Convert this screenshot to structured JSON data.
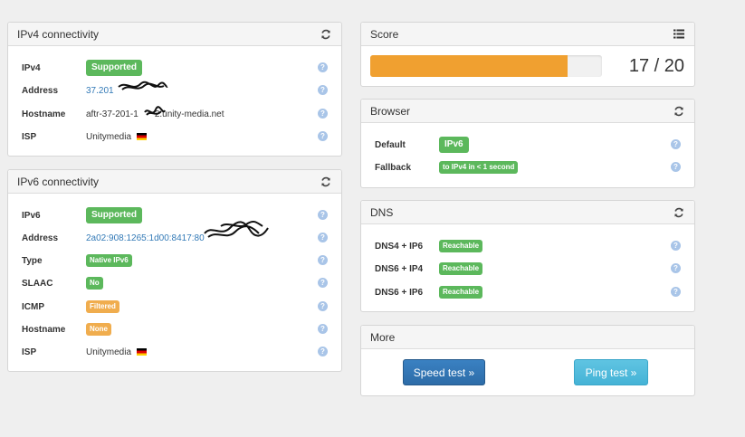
{
  "ipv4": {
    "title": "IPv4 connectivity",
    "rows": [
      {
        "key": "IPv4",
        "badge": "Supported"
      },
      {
        "key": "Address",
        "value": "37.201"
      },
      {
        "key": "Hostname",
        "value_a": "aftr-37-201-1",
        "value_b": "2.unity-media.net"
      },
      {
        "key": "ISP",
        "value": "Unitymedia"
      }
    ]
  },
  "ipv6": {
    "title": "IPv6 connectivity",
    "rows": [
      {
        "key": "IPv6",
        "badge": "Supported"
      },
      {
        "key": "Address",
        "value": "2a02:908:1265:1d00:8417:80"
      },
      {
        "key": "Type",
        "badge": "Native IPv6"
      },
      {
        "key": "SLAAC",
        "badge": "No"
      },
      {
        "key": "ICMP",
        "badge": "Filtered"
      },
      {
        "key": "Hostname",
        "badge": "None"
      },
      {
        "key": "ISP",
        "value": "Unitymedia"
      }
    ]
  },
  "score": {
    "title": "Score",
    "text": "17 / 20",
    "value": 17,
    "max": 20
  },
  "browser": {
    "title": "Browser",
    "rows": [
      {
        "key": "Default",
        "badge": "IPv6"
      },
      {
        "key": "Fallback",
        "badge": "to IPv4 in < 1 second"
      }
    ]
  },
  "dns": {
    "title": "DNS",
    "rows": [
      {
        "key": "DNS4 + IP6",
        "badge": "Reachable"
      },
      {
        "key": "DNS6 + IP4",
        "badge": "Reachable"
      },
      {
        "key": "DNS6 + IP6",
        "badge": "Reachable"
      }
    ]
  },
  "more": {
    "title": "More",
    "speed_label": "Speed test »",
    "ping_label": "Ping test »"
  },
  "help_glyph": "?",
  "colors": {
    "success": "#5cb85c",
    "warning": "#f0ad4e",
    "primary": "#337ab7",
    "info": "#5bc0de",
    "progress": "#f0a030"
  }
}
